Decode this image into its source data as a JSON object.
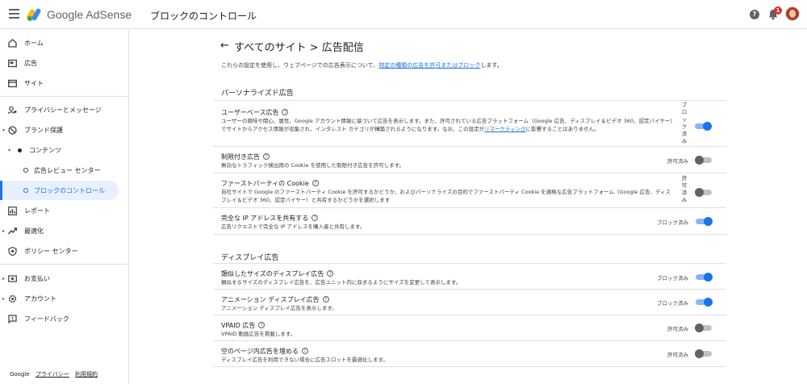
{
  "header": {
    "brand_google": "Google",
    "brand_product": "AdSense",
    "page_title": "ブロックのコントロール",
    "notification_count": "1"
  },
  "sidebar": {
    "items": [
      {
        "label": "ホーム",
        "icon": "home-icon"
      },
      {
        "label": "広告",
        "icon": "ads-icon"
      },
      {
        "label": "サイト",
        "icon": "sites-icon"
      },
      {
        "label": "プライバシーとメッセージ",
        "icon": "privacy-icon"
      },
      {
        "label": "ブランド保護",
        "icon": "brand-safety-icon"
      },
      {
        "label": "コンテンツ",
        "icon": "content-dot-icon"
      },
      {
        "label": "広告レビュー センター",
        "icon": "ring-icon"
      },
      {
        "label": "ブロックのコントロール",
        "icon": "ring-icon"
      },
      {
        "label": "レポート",
        "icon": "reports-icon"
      },
      {
        "label": "最適化",
        "icon": "optimization-icon"
      },
      {
        "label": "ポリシー センター",
        "icon": "policy-icon"
      },
      {
        "label": "お支払い",
        "icon": "payments-icon"
      },
      {
        "label": "アカウント",
        "icon": "gear-icon"
      },
      {
        "label": "フィードバック",
        "icon": "feedback-icon"
      }
    ],
    "footer": {
      "google": "Google",
      "privacy": "プライバシー",
      "terms": "利用規約"
    }
  },
  "main": {
    "breadcrumb": "すべてのサイト > 広告配信",
    "intro_text": "これらの設定を使用し、ウェブページでの広告表示について、",
    "intro_link": "特定の種類の広告を許可またはブロック",
    "intro_suffix": "します。",
    "sections": [
      {
        "title": "パーソナライズド広告",
        "rows": [
          {
            "title": "ユーザーベース広告",
            "desc": "ユーザーの興味や関心、属性、Google アカウント情報に基づいて広告を表示します。また、許可されている広告プラットフォーム（Google 広告、ディスプレイ＆ビデオ 360、認定バイヤー）でサイトからアクセス情報が収集され、インタレスト カテゴリが構築されるようになります。なお、この設定が",
            "desc_link": "リマーケティング",
            "desc_suffix": "に影響することはありません。",
            "status": "ブロック済み",
            "on": true
          },
          {
            "title": "制限付き広告",
            "desc": "無効なトラフィック検出用の Cookie を使用した制限付き広告を許可します。",
            "status": "許可済み",
            "on": false
          },
          {
            "title": "ファーストパーティの Cookie",
            "desc": "自社サイトで Google のファーストパーティ Cookie を許可するかどうか、およびパーソナライズの目的でファーストパーティ Cookie を適格な広告プラットフォーム（Google 広告、ディスプレイ＆ビデオ 360、認定バイヤー）と共有するかどうかを選択します",
            "status": "許可済み",
            "on": false
          },
          {
            "title": "完全な IP アドレスを共有する",
            "desc": "広告リクエストで完全な IP アドレスを購入者と共有します。",
            "status": "ブロック済み",
            "on": true
          }
        ]
      },
      {
        "title": "ディスプレイ広告",
        "rows": [
          {
            "title": "類似したサイズのディスプレイ広告",
            "desc": "類似するサイズのディスプレイ広告を、広告ユニット内に収まるようにサイズを変更して表示します。",
            "status": "ブロック済み",
            "on": true
          },
          {
            "title": "アニメーション ディスプレイ広告",
            "desc": "アニメーション ディスプレイ広告を表示します。",
            "status": "ブロック済み",
            "on": true
          },
          {
            "title": "VPAID 広告",
            "desc": "VPAID 動画広告を掲載します。",
            "status": "許可済み",
            "on": false
          },
          {
            "title": "空のページ内広告を埋める",
            "desc": "ディスプレイ広告を利用できない場合に広告スロットを最適化します。",
            "status": "許可済み",
            "on": false
          }
        ]
      }
    ]
  },
  "colors": {
    "accent": "#1a73e8",
    "active_bg": "#e8f0fe",
    "toggle_on_track": "#8ab4f8",
    "toggle_off_knob": "#5f6368"
  }
}
